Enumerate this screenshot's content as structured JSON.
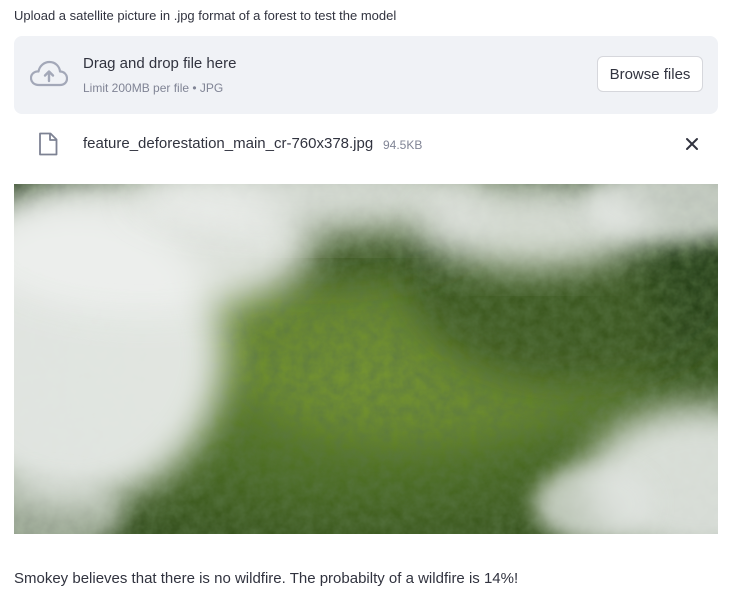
{
  "uploader": {
    "label": "Upload a satellite picture in .jpg format of a forest to test the model",
    "drop_title": "Drag and drop file here",
    "drop_limit": "Limit 200MB per file • JPG",
    "browse_label": "Browse files",
    "icon": "cloud-upload-icon"
  },
  "uploaded_file": {
    "name": "feature_deforestation_main_cr-760x378.jpg",
    "size": "94.5KB",
    "file_icon": "file-icon",
    "remove_icon": "close-icon"
  },
  "result": {
    "text": "Smokey believes that there is no wildfire. The probabilty of a wildfire is 14%!"
  },
  "colors": {
    "dropzone_bg": "#f0f2f6",
    "text": "#31333f",
    "muted_text": "#808495",
    "icon": "#a3a8b8"
  }
}
